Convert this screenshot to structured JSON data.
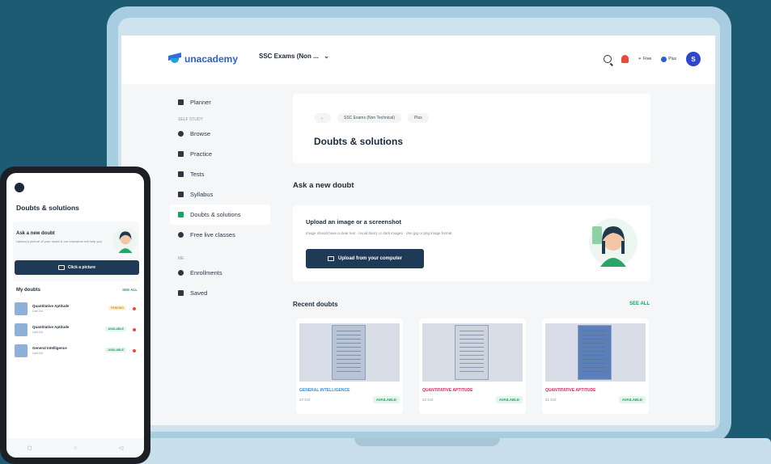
{
  "app": {
    "logo_text": "unacademy"
  },
  "topbar": {
    "exam_select": "SSC Exams (Non ...",
    "free_label": "Free",
    "plus_label": "Plus",
    "avatar_letter": "S"
  },
  "sidebar": {
    "planner": "Planner",
    "section_self_study": "SELF STUDY",
    "items": [
      "Browse",
      "Practice",
      "Tests",
      "Syllabus",
      "Doubts & solutions",
      "Free live classes"
    ],
    "section_me": "ME",
    "me_items": [
      "Enrollments",
      "Saved"
    ]
  },
  "header": {
    "breadcrumbs": [
      "←",
      "SSC Exams (Non Technical)",
      "Plus"
    ],
    "title": "Doubts & solutions"
  },
  "ask": {
    "title": "Ask a new doubt",
    "upload_title": "Upload an image or a screenshot",
    "upload_hint": "Image should have a clear text · Avoid blurry or dark images · Use jpg or png image format",
    "upload_button": "Upload from your computer"
  },
  "recent": {
    "title": "Recent doubts",
    "see_all": "SEE ALL",
    "cards": [
      {
        "subject": "GENERAL INTELLIGENCE",
        "meta": "27 Oct",
        "badge": "AVAILABLE",
        "color": "#3b8ede"
      },
      {
        "subject": "QUANTITATIVE APTITUDE",
        "meta": "22 Oct",
        "badge": "AVAILABLE",
        "color": "#e0245e"
      },
      {
        "subject": "QUANTITATIVE APTITUDE",
        "meta": "21 Oct",
        "badge": "AVAILABLE",
        "color": "#e0245e"
      }
    ]
  },
  "phone": {
    "title": "Doubts & solutions",
    "ask_title": "Ask a new doubt",
    "ask_hint": "Upload a picture of your doubt & our educators will help you",
    "button": "Click a picture",
    "my_doubts": "My doubts",
    "see_all": "SEE ALL",
    "rows": [
      {
        "subject": "Quantitative Aptitude",
        "sub": "Last Oct",
        "badge": "PENDING",
        "tone": "orange"
      },
      {
        "subject": "Quantitative Aptitude",
        "sub": "Last Oct",
        "badge": "AVAILABLE",
        "tone": "green"
      },
      {
        "subject": "General Intelligence",
        "sub": "Last Oct",
        "badge": "AVAILABLE",
        "tone": "green"
      }
    ],
    "nav": [
      "◻",
      "○",
      "◁"
    ]
  }
}
